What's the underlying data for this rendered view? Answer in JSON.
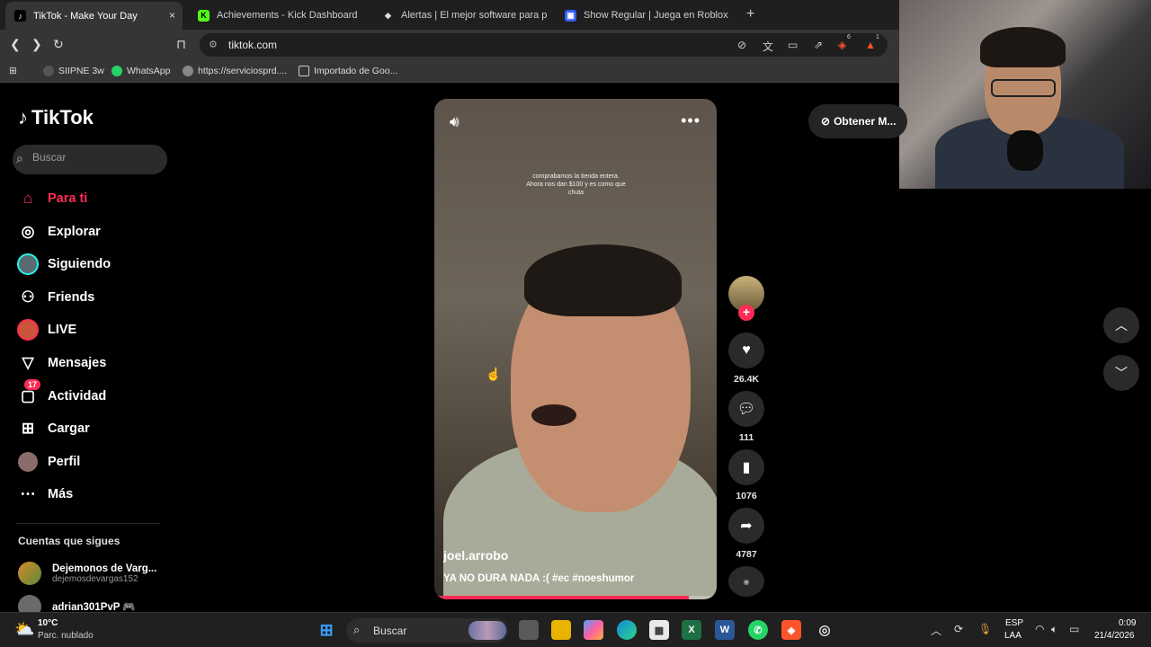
{
  "browser": {
    "tabs": [
      {
        "title": "TikTok - Make Your Day",
        "active": true
      },
      {
        "title": "Achievements - Kick Dashboard",
        "active": false
      },
      {
        "title": "Alertas | El mejor software para poten",
        "active": false
      },
      {
        "title": "Show Regular | Juega en Roblox",
        "active": false
      }
    ],
    "close_tab": "×",
    "new_tab": "+",
    "url": "tiktok.com",
    "bookmarks": [
      "SIIPNE 3w",
      "WhatsApp",
      "https://serviciosprd....",
      "Importado de Goo..."
    ],
    "extension_badges": [
      "6",
      "1"
    ]
  },
  "sidebar": {
    "logo": "TikTok",
    "search_placeholder": "Buscar",
    "nav": [
      {
        "label": "Para ti",
        "icon": "home-icon"
      },
      {
        "label": "Explorar",
        "icon": "compass-icon"
      },
      {
        "label": "Siguiendo",
        "icon": "following-avatar-icon"
      },
      {
        "label": "Friends",
        "icon": "friends-icon"
      },
      {
        "label": "LIVE",
        "icon": "live-icon"
      },
      {
        "label": "Mensajes",
        "icon": "send-icon"
      },
      {
        "label": "Actividad",
        "icon": "activity-icon",
        "badge": "17"
      },
      {
        "label": "Cargar",
        "icon": "upload-icon"
      },
      {
        "label": "Perfil",
        "icon": "profile-avatar-icon"
      },
      {
        "label": "Más",
        "icon": "more-icon"
      }
    ],
    "following_title": "Cuentas que sigues",
    "accounts": [
      {
        "name": "Dejemonos de Varg...",
        "handle": "dejemosdevargas152"
      },
      {
        "name": "adrian301PvP 🎮",
        "handle": ""
      }
    ]
  },
  "video": {
    "overlay_text": "comprabamos la tienda entera. Ahora nos dan $100 y es como que chuta",
    "username": "joel.arrobo",
    "description": "YA NO DURA NADA :( #ec #noeshumor",
    "progress": 0.9
  },
  "actions": {
    "likes": "26.4K",
    "comments": "111",
    "saves": "1076",
    "shares": "4787"
  },
  "get_app_label": "Obtener M...",
  "taskbar": {
    "temperature": "10°C",
    "condition": "Parc. nublado",
    "search_label": "Buscar",
    "lang_line1": "ESP",
    "lang_line2": "LAA",
    "time": "0:09",
    "date": "21/4/2026"
  },
  "colors": {
    "accent": "#fe2c55",
    "background": "#000000"
  }
}
